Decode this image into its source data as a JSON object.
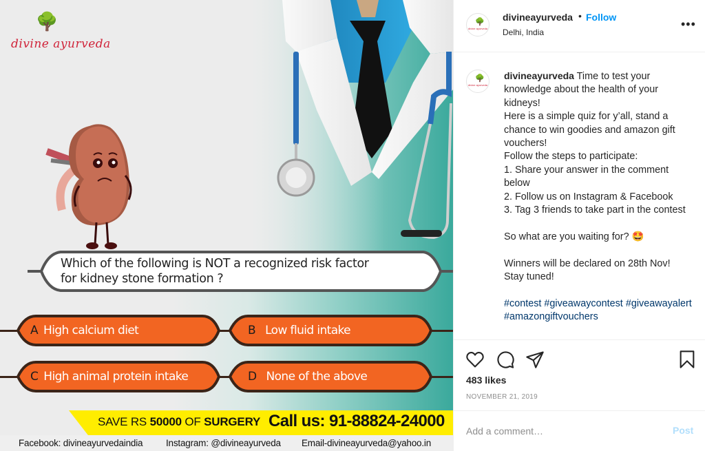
{
  "post_image": {
    "brand_name": "divine ayurveda",
    "brand_icon": "tree-yoga-icon",
    "question": "Which of the following is NOT a recognized risk factor for kidney stone formation ?",
    "options": [
      {
        "letter": "A",
        "text": "High calcium diet"
      },
      {
        "letter": "B",
        "text": "Low fluid intake"
      },
      {
        "letter": "C",
        "text": "High animal protein intake"
      },
      {
        "letter": "D",
        "text": "None of the above"
      }
    ],
    "save_prefix": "SAVE RS ",
    "save_amount": "50000",
    "save_mid": " OF ",
    "save_suffix": "SURGERY",
    "call": "Call us: 91-88824-24000",
    "contacts": {
      "facebook": "Facebook: divineayurvedaindia",
      "instagram": "Instagram: @divineayurveda",
      "email": "Email-divineayurveda@yahoo.in"
    },
    "colors": {
      "option_fill": "#f26522",
      "option_border": "#3b2418",
      "banner": "#ffed00",
      "teal": "#3aa99c"
    }
  },
  "header": {
    "username": "divineayurveda",
    "separator": "•",
    "follow_label": "Follow",
    "location": "Delhi, India",
    "more_icon": "•••"
  },
  "caption": {
    "username": "divineayurveda",
    "first_line": " Time to test your knowledge about the health of your kidneys!",
    "lines": [
      "Here is a simple quiz for y’all, stand a chance to win goodies and amazon gift vouchers!",
      "Follow the steps to participate:",
      "1. Share your answer in the comment below",
      "2. Follow us on Instagram & Facebook",
      "3. Tag 3 friends to take part in the contest",
      "",
      "So what are you waiting for? 🤩",
      "",
      "Winners will be declared on 28th Nov!",
      "Stay tuned!",
      ""
    ],
    "hashtags": [
      "#contest",
      "#giveawaycontest",
      "#giveawayalert",
      "#amazongiftvouchers"
    ]
  },
  "actions": {
    "likes": "483 likes",
    "date": "NOVEMBER 21, 2019"
  },
  "comment": {
    "placeholder": "Add a comment…",
    "post_label": "Post"
  },
  "colors": {
    "link_blue": "#0095f6",
    "hashtag": "#00376b",
    "text": "#262626",
    "muted": "#8e8e8e"
  }
}
